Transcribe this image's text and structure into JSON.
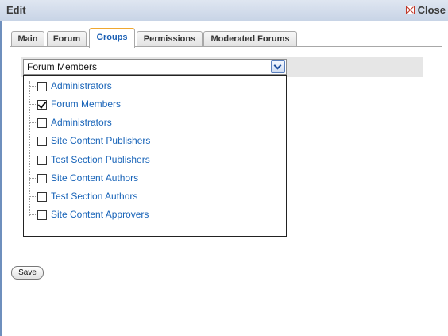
{
  "window": {
    "title": "Edit",
    "close_label": "Close"
  },
  "tabs": [
    {
      "label": "Main",
      "active": false
    },
    {
      "label": "Forum",
      "active": false
    },
    {
      "label": "Groups",
      "active": true
    },
    {
      "label": "Permissions",
      "active": false
    },
    {
      "label": "Moderated Forums",
      "active": false
    }
  ],
  "groups_select": {
    "value": "Forum Members",
    "options": [
      {
        "label": "Administrators",
        "checked": false
      },
      {
        "label": "Forum Members",
        "checked": true
      },
      {
        "label": "Administrators",
        "checked": false
      },
      {
        "label": "Site Content Publishers",
        "checked": false
      },
      {
        "label": "Test Section Publishers",
        "checked": false
      },
      {
        "label": "Site Content Authors",
        "checked": false
      },
      {
        "label": "Test Section Authors",
        "checked": false
      },
      {
        "label": "Site Content Approvers",
        "checked": false
      }
    ]
  },
  "footer": {
    "save_label": "Save"
  },
  "colors": {
    "link": "#1763b8",
    "active_tab_accent": "#f0a830",
    "titlebar": "#c8d4e6"
  }
}
